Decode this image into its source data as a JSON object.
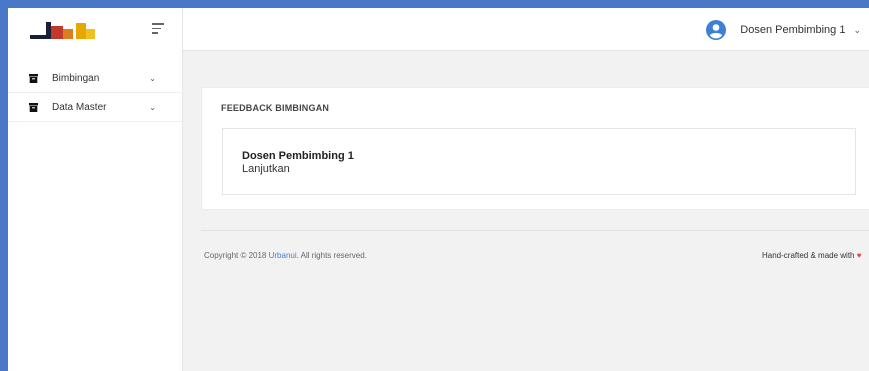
{
  "header": {
    "user_name": "Dosen Pembimbing 1",
    "user_caret": "⌄",
    "brand_colors": [
      "#1a1f3a",
      "#c0392b",
      "#e6a800"
    ]
  },
  "sidebar": {
    "items": [
      {
        "label": "Bimbingan",
        "icon": "archive-icon",
        "caret": "⌄"
      },
      {
        "label": "Data Master",
        "icon": "archive-icon",
        "caret": "⌄"
      }
    ]
  },
  "main": {
    "card_title": "FEEDBACK BIMBINGAN",
    "feedback": {
      "name": "Dosen Pembimbing 1",
      "message": "Lanjutkan"
    }
  },
  "footer": {
    "copyright_prefix": "Copyright © 2018 ",
    "brand_link": "Urbanui",
    "copyright_suffix": ". All rights reserved.",
    "credit": "Hand-crafted & made with",
    "heart": "♥"
  },
  "colors": {
    "outer_border": "#4a78c9",
    "link": "#4a7fd1",
    "avatar": "#3f7fd6"
  }
}
